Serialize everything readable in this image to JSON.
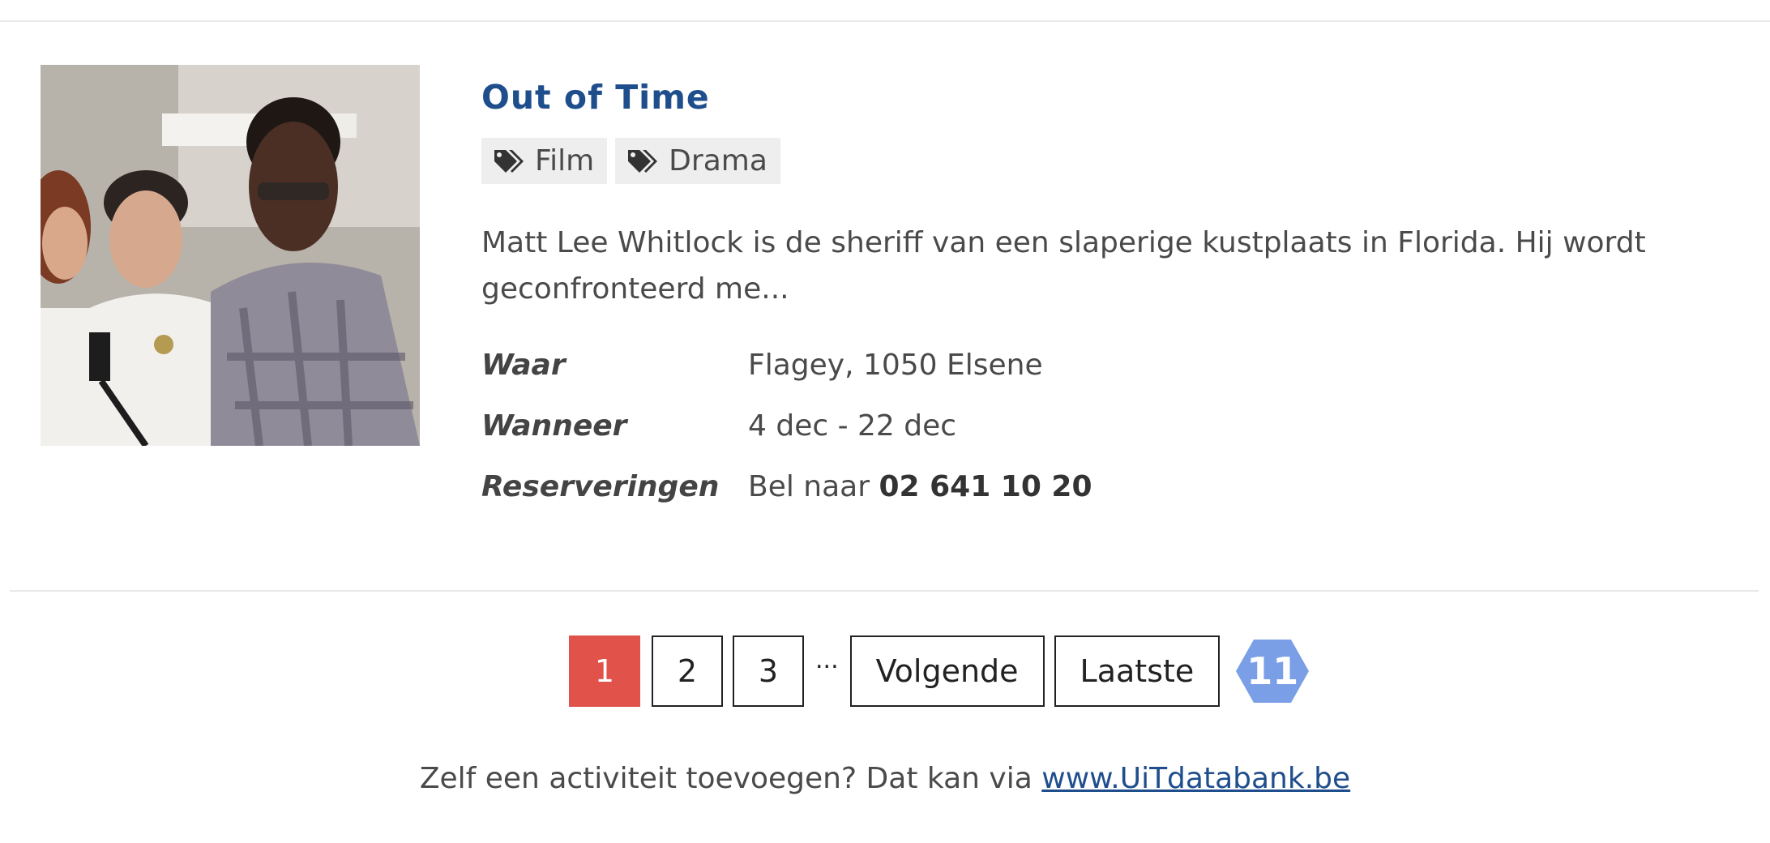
{
  "event": {
    "title": "Out of Time",
    "tags": [
      {
        "label": "Film",
        "icon": "tags-icon"
      },
      {
        "label": "Drama",
        "icon": "tags-icon"
      }
    ],
    "description": "Matt Lee Whitlock is de sheriff van een slaperige kustplaats in Florida. Hij wordt geconfronteerd me...",
    "details": {
      "where": {
        "label": "Waar",
        "value": "Flagey, 1050 Elsene"
      },
      "when": {
        "label": "Wanneer",
        "value": "4 dec - 22 dec"
      },
      "reservations": {
        "label": "Reserveringen",
        "prefix": "Bel naar",
        "phone": "02 641 10 20"
      }
    },
    "image_alt": "Out of Time"
  },
  "pagination": {
    "pages": [
      "1",
      "2",
      "3"
    ],
    "current": "1",
    "ellipsis": "...",
    "next_label": "Volgende",
    "last_label": "Laatste",
    "total_pages": "11"
  },
  "footer": {
    "text": "Zelf een activiteit toevoegen? Dat kan via",
    "link_text": "www.UiTdatabank.be"
  },
  "colors": {
    "title": "#1f4e8c",
    "active_page": "#e0524a",
    "badge": "#7b9fe6",
    "link": "#1f4e8c"
  }
}
